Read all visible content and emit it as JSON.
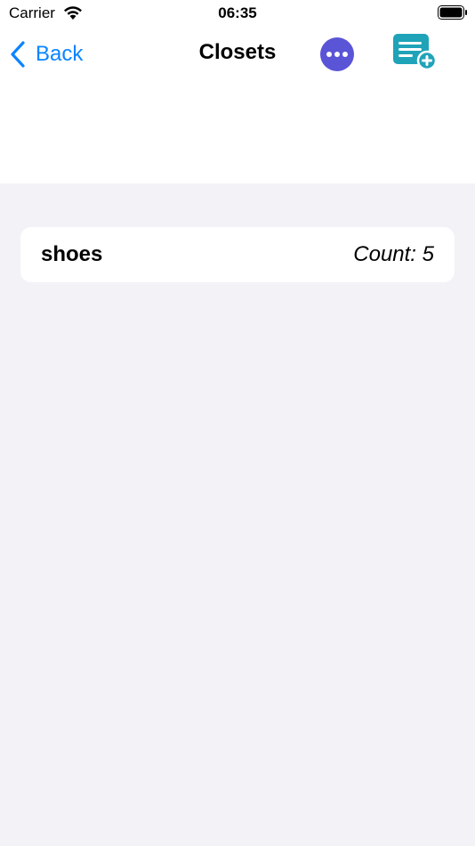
{
  "status_bar": {
    "carrier": "Carrier",
    "time": "06:35",
    "wifi_icon": "wifi-icon",
    "battery_icon": "battery-full-icon"
  },
  "nav": {
    "back_label": "Back",
    "back_icon": "chevron-left-icon",
    "title": "Closets",
    "more_icon": "ellipsis-circle-icon",
    "add_icon": "list-add-icon"
  },
  "closets": [
    {
      "name": "shoes",
      "count_label": "Count: 5"
    }
  ],
  "colors": {
    "accent": "#0a84ff",
    "more_button": "#5a55d6",
    "add_icon": "#1fa3b8",
    "background": "#f2f2f7"
  }
}
